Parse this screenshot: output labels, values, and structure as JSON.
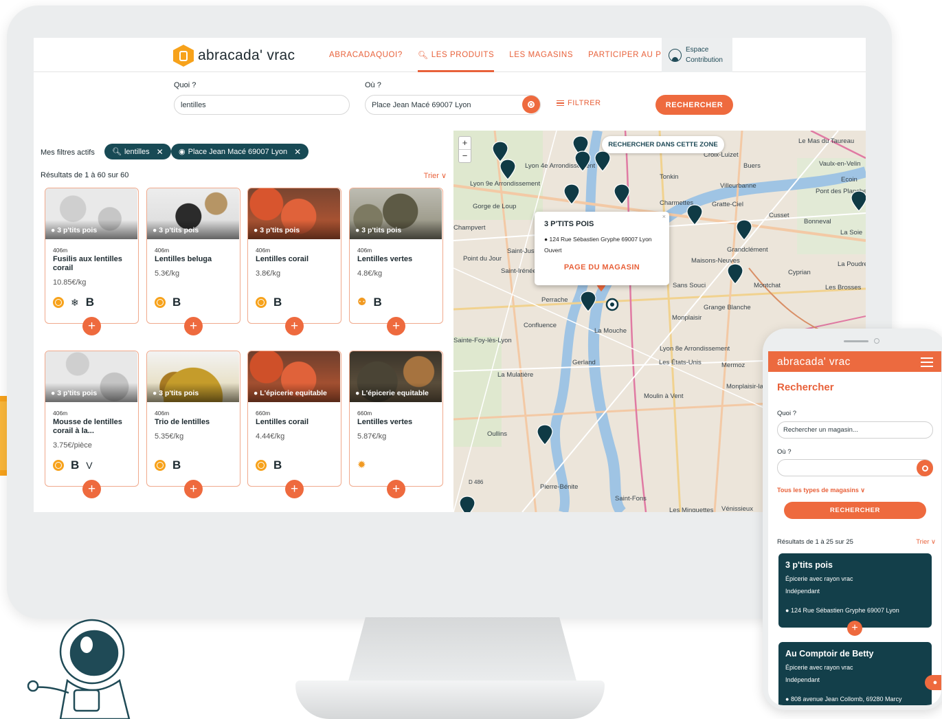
{
  "header": {
    "logo": "abracada' vrac",
    "nav": [
      {
        "label": "ABRACADAQUOI?",
        "active": false
      },
      {
        "label": "LES PRODUITS",
        "active": true
      },
      {
        "label": "LES MAGASINS",
        "active": false
      },
      {
        "label": "PARTICIPER AU PROJET",
        "active": false
      }
    ],
    "espace_line1": "Espace",
    "espace_line2": "Contribution"
  },
  "search": {
    "quoi_label": "Quoi ?",
    "quoi_value": "lentilles",
    "ou_label": "Où ?",
    "ou_value": "Place Jean Macé 69007 Lyon",
    "filter_label": "FILTRER",
    "submit_label": "RECHERCHER"
  },
  "filters": {
    "label": "Mes filtres actifs",
    "chips": [
      "lentilles",
      "Place Jean Macé 69007 Lyon"
    ]
  },
  "results": {
    "count": "Résultats de 1 à 60 sur 60",
    "sort": "Trier",
    "products": [
      {
        "shop": "3 p'tits pois",
        "distance": "406m",
        "name": "Fusilis aux lentilles corail",
        "price": "10.85€/kg"
      },
      {
        "shop": "3 p'tits pois",
        "distance": "406m",
        "name": "Lentilles beluga",
        "price": "5.3€/kg"
      },
      {
        "shop": "3 p'tits pois",
        "distance": "406m",
        "name": "Lentilles corail",
        "price": "3.8€/kg"
      },
      {
        "shop": "3 p'tits pois",
        "distance": "406m",
        "name": "Lentilles vertes",
        "price": "4.8€/kg"
      },
      {
        "shop": "3 p'tits pois",
        "distance": "406m",
        "name": "Mousse de lentilles corail à la...",
        "price": "3.75€/pièce"
      },
      {
        "shop": "3 p'tits pois",
        "distance": "406m",
        "name": "Trio de lentilles",
        "price": "5.35€/kg"
      },
      {
        "shop": "L'épicerie equitable",
        "distance": "660m",
        "name": "Lentilles corail",
        "price": "4.44€/kg"
      },
      {
        "shop": "L'épicerie equitable",
        "distance": "660m",
        "name": "Lentilles vertes",
        "price": "5.87€/kg"
      }
    ]
  },
  "map": {
    "search_area": "RECHERCHER DANS CETTE ZONE",
    "zoom_in": "+",
    "zoom_out": "−",
    "popup": {
      "title": "3 P'TITS POIS",
      "address": "124 Rue Sébastien Gryphe 69007 Lyon",
      "status": "Ouvert",
      "link": "PAGE DU MAGASIN",
      "close": "×"
    },
    "labels": [
      "Lyon 4e Arrondissement",
      "Lyon 9e Arrondissement",
      "Gorge de Loup",
      "Villeurbanne",
      "Buers",
      "Vaulx-en-Velin",
      "Tonkin",
      "Charmettes",
      "Gratte-Ciel",
      "Cusset",
      "Bonneval",
      "Grandclément",
      "Maisons-Neuves",
      "Montchat",
      "Saint-Just",
      "Saint-Irénée",
      "Point du Jour",
      "Perrache",
      "Confluence",
      "La Mouche",
      "Gerland",
      "La Mulatière",
      "Sans Souci",
      "Monplaisir",
      "Grange Blanche",
      "Lyon 8e Arrondissement",
      "Les États-Unis",
      "Mermoz",
      "Monplaisir-la-Plaine",
      "Moulin à Vent",
      "Oullins",
      "Pierre-Bénite",
      "Saint-Fons",
      "Vénissieux",
      "Les Minguettes",
      "Sainte-Foy-lès-Lyon",
      "Champvert",
      "Le Mas du Taureau",
      "Ecoin",
      "Pont des Planches",
      "La Soie",
      "Cyprian",
      "La Poudre",
      "Les Brosses",
      "Croix-Luizet",
      "D 486"
    ]
  },
  "phone": {
    "logo": "abracada' vrac",
    "title": "Rechercher",
    "quoi_label": "Quoi ?",
    "quoi_placeholder": "Rechercher un magasin...",
    "ou_label": "Où ?",
    "types_label": "Tous les types de magasins",
    "submit_label": "RECHERCHER",
    "count": "Résultats de 1 à 25 sur 25",
    "sort": "Trier",
    "shops": [
      {
        "name": "3 p'tits pois",
        "type": "Épicerie avec rayon vrac",
        "status": "Indépendant",
        "address": "124 Rue Sébastien Gryphe 69007 Lyon"
      },
      {
        "name": "Au Comptoir de Betty",
        "type": "Épicerie avec rayon vrac",
        "status": "Indépendant",
        "address": "808 avenue Jean Collomb, 69280 Marcy"
      }
    ]
  },
  "colors": {
    "accent": "#ee6a3e",
    "dark": "#184a55",
    "yellow": "#f7a21b"
  }
}
